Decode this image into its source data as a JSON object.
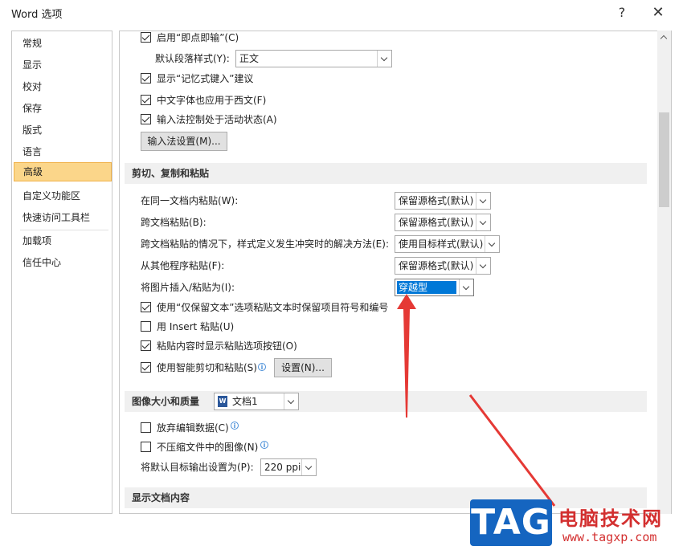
{
  "window": {
    "title": "Word 选项",
    "help": "?",
    "close": "✕"
  },
  "nav": {
    "items": [
      "常规",
      "显示",
      "校对",
      "保存",
      "版式",
      "语言",
      "高级",
      "自定义功能区",
      "快速访问工具栏",
      "加载项",
      "信任中心"
    ],
    "active": "高级"
  },
  "options_top": [
    {
      "label": "启用“即点即输”(C)",
      "checked": true
    },
    {
      "label": "默认段落样式(Y):",
      "value": "正文"
    },
    {
      "label": "显示“记忆式键入”建议",
      "checked": true
    },
    {
      "label": "中文字体也应用于西文(F)",
      "checked": true
    },
    {
      "label": "输入法控制处于活动状态(A)",
      "checked": true
    }
  ],
  "ime_button": "输入法设置(M)...",
  "cut_copy_paste": {
    "header": "剪切、复制和粘贴",
    "rows": [
      {
        "label": "在同一文档内粘贴(W):",
        "value": "保留源格式(默认)"
      },
      {
        "label": "跨文档粘贴(B):",
        "value": "保留源格式(默认)"
      },
      {
        "label": "跨文档粘贴的情况下，样式定义发生冲突时的解决方法(E):",
        "value": "使用目标样式(默认)"
      },
      {
        "label": "从其他程序粘贴(F):",
        "value": "保留源格式(默认)"
      },
      {
        "label": "将图片插入/粘贴为(I):",
        "value": "穿越型"
      }
    ],
    "checks": [
      {
        "label": "使用“仅保留文本”选项粘贴文本时保留项目符号和编号",
        "checked": true
      },
      {
        "label": "用 Insert 粘贴(U)",
        "checked": false
      },
      {
        "label": "粘贴内容时显示粘贴选项按钮(O)",
        "checked": true
      },
      {
        "label": "使用智能剪切和粘贴(S)",
        "checked": true
      }
    ],
    "settings_button": "设置(N)..."
  },
  "image_quality": {
    "header": "图像大小和质量",
    "doc": "文档1",
    "checks": [
      {
        "label": "放弃编辑数据(C)",
        "checked": false
      },
      {
        "label": "不压缩文件中的图像(N)",
        "checked": false
      }
    ],
    "output_label": "将默认目标输出设置为(P):",
    "output_value": "220 ppi"
  },
  "display_header": "显示文档内容",
  "watermark": {
    "tag": "TAG",
    "site": "电脑技术网",
    "url": "www.tagxp.com"
  },
  "colors": {
    "accent": "#0078d7",
    "nav_active": "#fbd68a",
    "annotation": "#e53935"
  }
}
